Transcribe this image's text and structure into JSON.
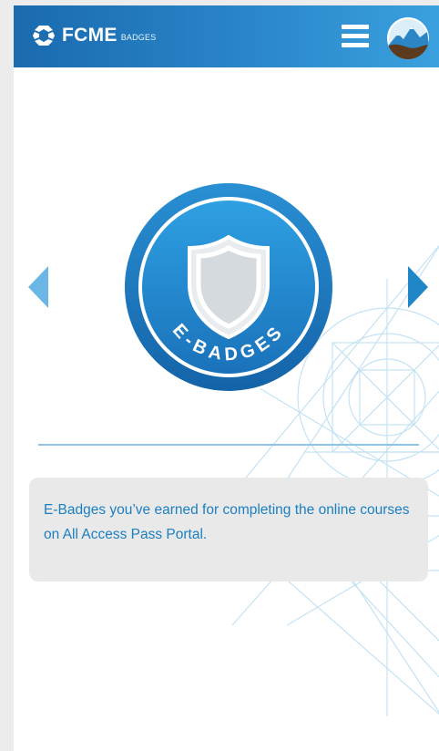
{
  "header": {
    "brand": "FCME",
    "brand_sub": "BADGES",
    "logo_icon": "fcme-logo-icon",
    "menu_icon": "hamburger-menu-icon",
    "avatar_icon": "mountain-avatar-icon"
  },
  "carousel": {
    "badge_label": "E-BADGES",
    "badge_icon": "shield-icon",
    "prev_icon": "chevron-left-icon",
    "next_icon": "chevron-right-icon"
  },
  "description": {
    "text": "E-Badges you’ve earned for completing the online courses on All Access Pass Portal."
  },
  "colors": {
    "header_start": "#1a6aae",
    "header_end": "#3aa0de",
    "badge_blue": "#1f7dc3",
    "text_blue": "#1b7fc0",
    "arrow_left": "#6ab6e4",
    "arrow_right": "#1f86c8",
    "card_bg": "#e8e8e8"
  }
}
